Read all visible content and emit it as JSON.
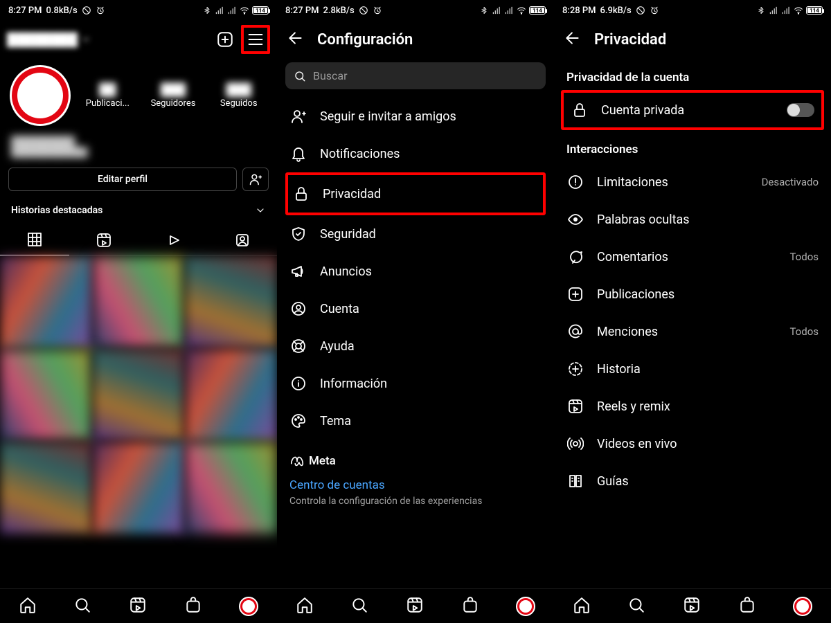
{
  "status": {
    "p1": {
      "time": "8:27 PM",
      "net": "0.8kB/s",
      "battery": "114"
    },
    "p2": {
      "time": "8:27 PM",
      "net": "2.8kB/s",
      "battery": "114"
    },
    "p3": {
      "time": "8:28 PM",
      "net": "6.9kB/s",
      "battery": "114"
    }
  },
  "profile": {
    "stats": {
      "posts_label": "Publicaci...",
      "followers_label": "Seguidores",
      "following_label": "Seguidos"
    },
    "edit_button": "Editar perfil",
    "highlights_label": "Historias destacadas"
  },
  "settings": {
    "title": "Configuración",
    "search_placeholder": "Buscar",
    "items": [
      {
        "key": "follow",
        "label": "Seguir e invitar a amigos"
      },
      {
        "key": "notif",
        "label": "Notificaciones"
      },
      {
        "key": "privacy",
        "label": "Privacidad"
      },
      {
        "key": "security",
        "label": "Seguridad"
      },
      {
        "key": "ads",
        "label": "Anuncios"
      },
      {
        "key": "account",
        "label": "Cuenta"
      },
      {
        "key": "help",
        "label": "Ayuda"
      },
      {
        "key": "info",
        "label": "Información"
      },
      {
        "key": "theme",
        "label": "Tema"
      }
    ],
    "meta": {
      "brand": "Meta",
      "accounts_center": "Centro de cuentas",
      "description": "Controla la configuración de las experiencias"
    }
  },
  "privacy": {
    "title": "Privacidad",
    "section_account": "Privacidad de la cuenta",
    "private_account": "Cuenta privada",
    "section_interactions": "Interacciones",
    "items": [
      {
        "key": "limits",
        "label": "Limitaciones",
        "value": "Desactivado"
      },
      {
        "key": "hidden",
        "label": "Palabras ocultas"
      },
      {
        "key": "comments",
        "label": "Comentarios",
        "value": "Todos"
      },
      {
        "key": "posts",
        "label": "Publicaciones"
      },
      {
        "key": "mentions",
        "label": "Menciones",
        "value": "Todos"
      },
      {
        "key": "story",
        "label": "Historia"
      },
      {
        "key": "reels",
        "label": "Reels y remix"
      },
      {
        "key": "live",
        "label": "Videos en vivo"
      },
      {
        "key": "guides",
        "label": "Guías"
      }
    ]
  }
}
